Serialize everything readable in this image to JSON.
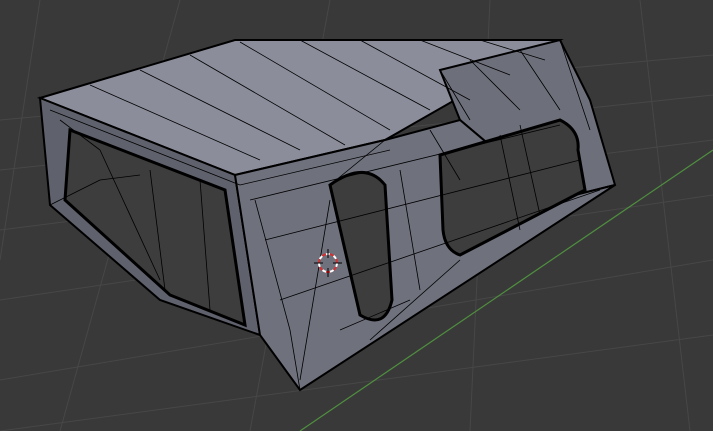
{
  "viewport": {
    "background": "#393939",
    "grid_color": "#4a4a4a",
    "x_axis_color": "#b04545",
    "y_axis_color": "#4f8f3f",
    "mesh_face_color": "#71737f",
    "mesh_wire_color": "#000000"
  },
  "cursor": {
    "icon": "3d-cursor-icon",
    "ring_colors": [
      "#d43030",
      "#ffffff"
    ]
  }
}
